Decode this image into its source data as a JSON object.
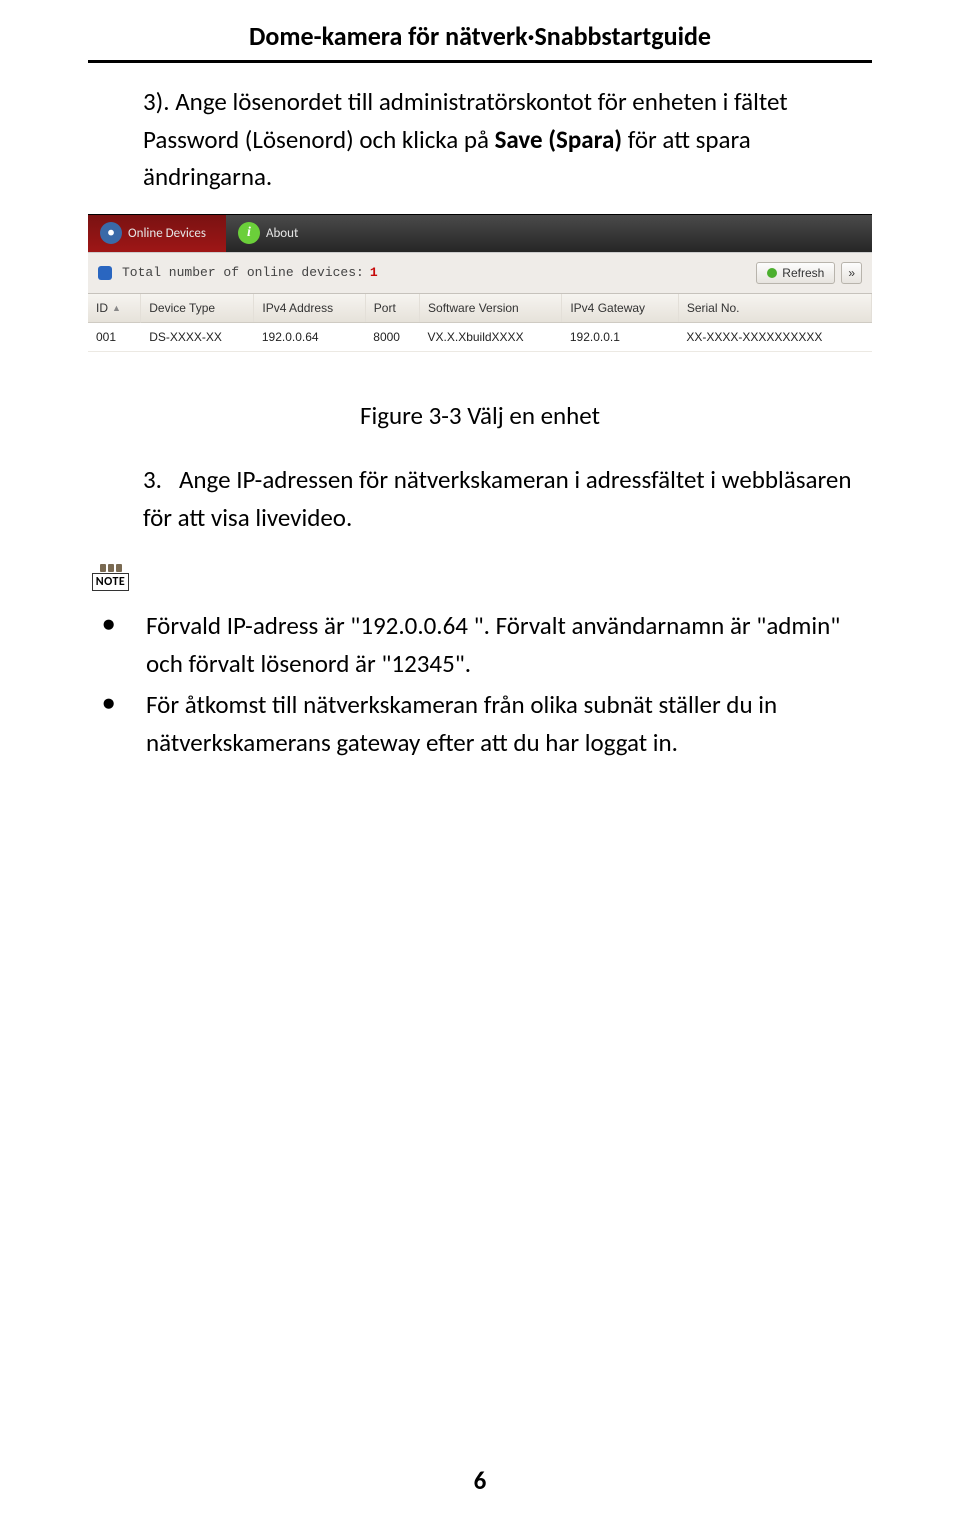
{
  "header": {
    "title": "Dome-kamera för nätverk·Snabbstartguide"
  },
  "para3": {
    "prefix": "3). Ange lösenordet till administratörskontot för enheten i fältet Password (Lösenord) och klicka på ",
    "bold": "Save (Spara) ",
    "suffix": "för att spara ändringarna."
  },
  "screenshot": {
    "tabs": {
      "online_devices": "Online Devices",
      "about": "About"
    },
    "toolbar": {
      "total_label": "Total number of online devices:",
      "total_value": "1",
      "refresh": "Refresh",
      "expand": "»"
    },
    "columns": {
      "id": "ID",
      "device_type": "Device Type",
      "ipv4_address": "IPv4 Address",
      "port": "Port",
      "software_version": "Software Version",
      "ipv4_gateway": "IPv4 Gateway",
      "serial_no": "Serial No."
    },
    "row": {
      "id": "001",
      "device_type": "DS-XXXX-XX",
      "ipv4_address": "192.0.0.64",
      "port": "8000",
      "software_version": "VX.X.XbuildXXXX",
      "ipv4_gateway": "192.0.0.1",
      "serial_no": "XX-XXXX-XXXXXXXXXX"
    }
  },
  "figure_caption": "Figure 3-3 Välj en enhet",
  "para_ip": {
    "num": "3.",
    "text": "Ange IP-adressen för nätverkskameran i adressfältet i webbläsaren för att visa livevideo."
  },
  "note_label": "NOTE",
  "bullets": [
    "Förvald IP-adress är \"192.0.0.64 \". Förvalt användarnamn är \"admin\" och förvalt lösenord är \"12345\".",
    "För åtkomst till nätverkskameran från olika subnät ställer du in nätverkskamerans gateway efter att du har loggat in."
  ],
  "page_number": "6"
}
